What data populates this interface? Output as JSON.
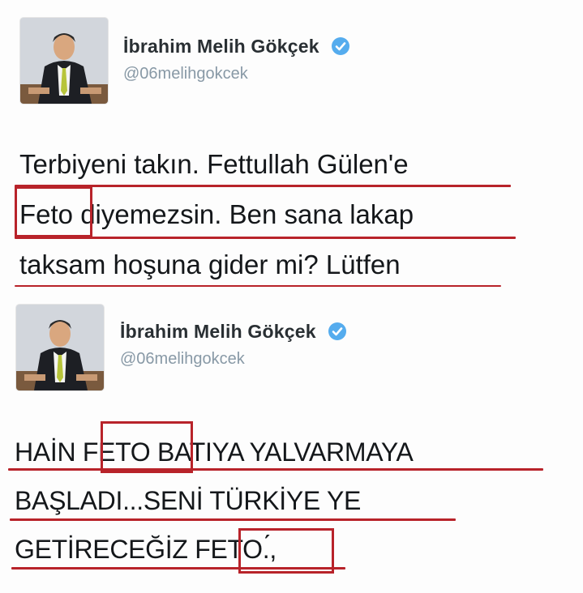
{
  "tweets": [
    {
      "author": {
        "name": "İbrahim Melih Gökçek",
        "handle": "@06melihgokcek",
        "verified_icon": "verified-badge-icon"
      },
      "lines": [
        {
          "text": "Terbiyeni takın. Fettullah Gülen'e"
        },
        {
          "text": "Feto diyemezsin. Ben sana lakap"
        },
        {
          "text": "taksam hoşuna gider mi? Lütfen"
        }
      ],
      "highlight": "Feto"
    },
    {
      "author": {
        "name": "İbrahim Melih Gökçek",
        "handle": "@06melihgokcek",
        "verified_icon": "verified-badge-icon"
      },
      "lines": [
        {
          "text": "HAİN FETO BATIYA YALVARMAYA"
        },
        {
          "text": "BAŞLADI...SENİ TÜRKİYE YE"
        },
        {
          "text": "GETİRECEĞİZ FETO.́,"
        }
      ],
      "highlight": "FETO"
    }
  ],
  "colors": {
    "annotation_red": "#b8232a",
    "verified_blue": "#55acee",
    "name_text": "#292f33",
    "handle_text": "#8899a6",
    "body_text": "#14171a"
  }
}
